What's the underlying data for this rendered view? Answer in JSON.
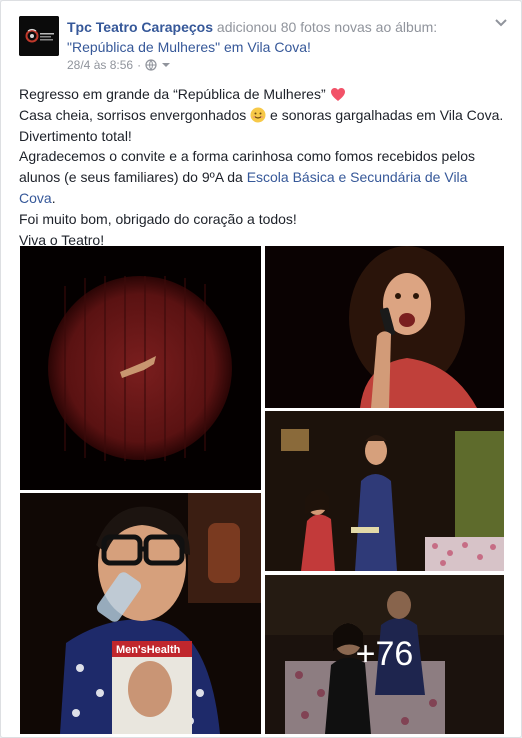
{
  "header": {
    "page_name": "Tpc Teatro Carapeços",
    "action": " adicionou 80 fotos novas ao álbum:",
    "album_title": "\"República de Mulheres\" em Vila Cova!",
    "timestamp": "28/4 às 8:56",
    "separator": "·",
    "privacy_icon": "globe-icon",
    "menu_icon": "chevron-down-icon"
  },
  "post": {
    "line1_text": "Regresso em grande da “República de Mulheres” ",
    "line1_emoji": "heart-emoji",
    "line2_a": "Casa cheia, sorrisos envergonhados ",
    "line2_emoji": "smile-emoji",
    "line2_b": " e sonoras gargalhadas em Vila Cova.",
    "line3": "Divertimento total!",
    "line4": "Agradecemos o convite e a forma carinhosa como fomos recebidos pelos",
    "line5_a": "alunos (e seus familiares) do 9ºA da ",
    "line5_link": "Escola Básica e Secundária de Vila",
    "line6_link": "Cova",
    "line6_b": ".",
    "line7": "Foi muito bom, obrigado do coração a todos!",
    "line8": "Viva o Teatro!"
  },
  "photos": {
    "more_count": "+76"
  },
  "colors": {
    "link": "#365899",
    "meta": "#90949c",
    "text": "#1d2129"
  }
}
